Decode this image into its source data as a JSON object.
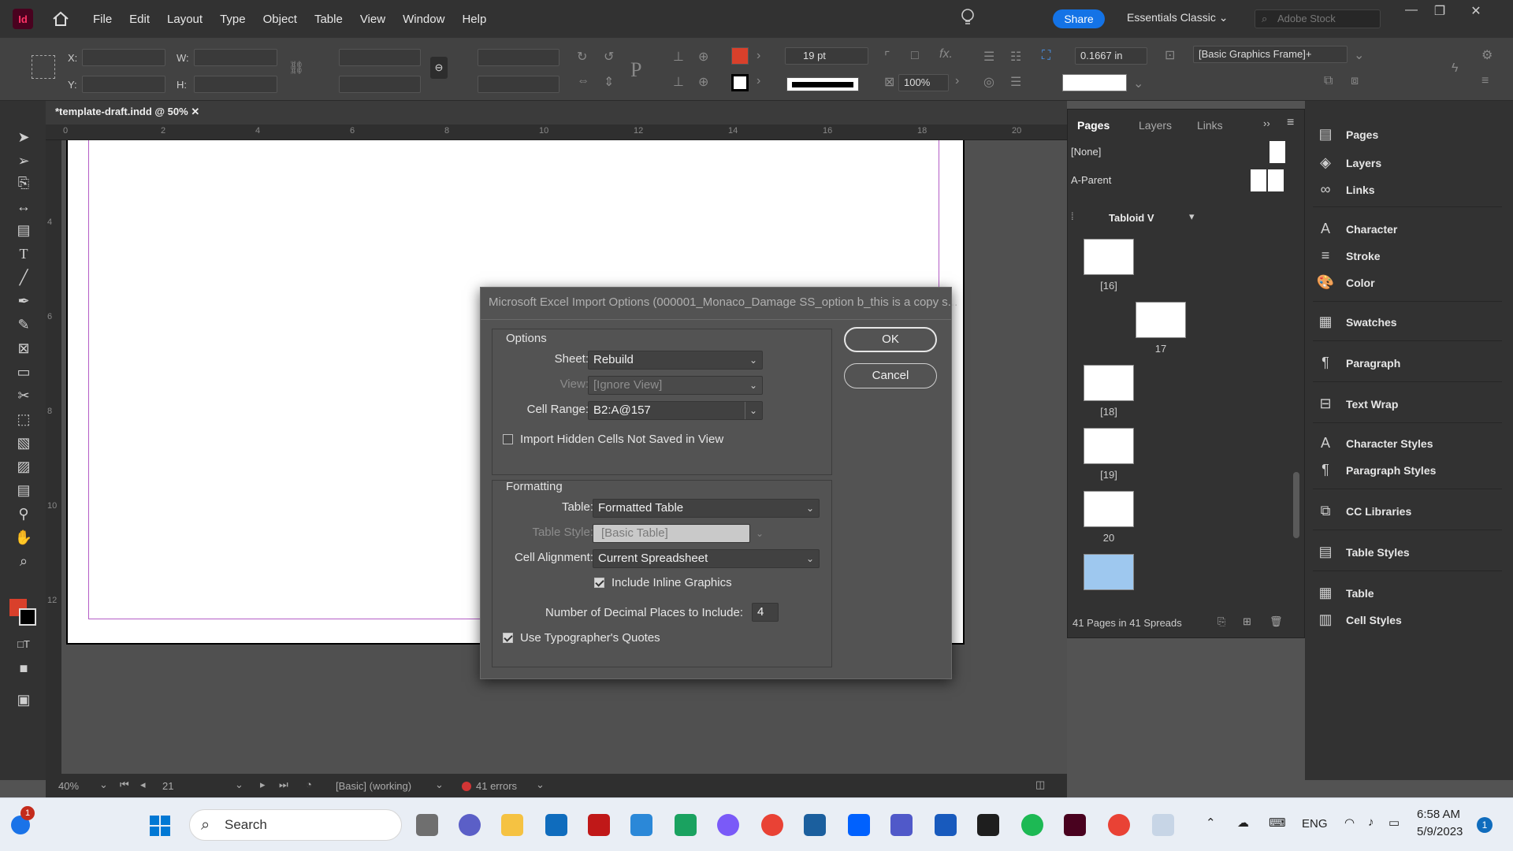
{
  "app": {
    "logo": "Id",
    "menu": [
      "File",
      "Edit",
      "Layout",
      "Type",
      "Object",
      "Table",
      "View",
      "Window",
      "Help"
    ],
    "share_label": "Share",
    "workspace": "Essentials Classic",
    "stock_placeholder": "Adobe Stock"
  },
  "controlbar": {
    "x_label": "X:",
    "y_label": "Y:",
    "w_label": "W:",
    "h_label": "H:",
    "stroke_weight": "19 pt",
    "opacity": "100%",
    "offset": "0.1667 in",
    "object_style": "[Basic Graphics Frame]+",
    "fill_color": "#d9402b",
    "stroke_color": "#000000"
  },
  "document": {
    "tab_title": "*template-draft.indd @ 50%",
    "ruler_marks": [
      "0",
      "2",
      "4",
      "6",
      "8",
      "10",
      "12",
      "14",
      "16",
      "18",
      "20"
    ],
    "ruler_marks_left": [
      "4",
      "6",
      "8",
      "10",
      "12"
    ]
  },
  "status": {
    "zoom": "40%",
    "page": "21",
    "preflight_profile": "[Basic] (working)",
    "errors": "41 errors"
  },
  "pages_panel": {
    "tabs": [
      "Pages",
      "Layers",
      "Links"
    ],
    "parents": [
      "[None]",
      "A-Parent"
    ],
    "size": "Tabloid V",
    "pages": [
      "[16]",
      "17",
      "[18]",
      "[19]",
      "20"
    ],
    "footer": "41 Pages in 41 Spreads"
  },
  "dock": {
    "items": [
      "Pages",
      "Layers",
      "Links",
      "Character",
      "Stroke",
      "Color",
      "Swatches",
      "Paragraph",
      "Text Wrap",
      "Character Styles",
      "Paragraph Styles",
      "CC Libraries",
      "Table Styles",
      "Table",
      "Cell Styles"
    ]
  },
  "dialog": {
    "title": "Microsoft Excel Import Options (000001_Monaco_Damage SS_option b_this is a copy s...",
    "ok": "OK",
    "cancel": "Cancel",
    "options_title": "Options",
    "sheet_label": "Sheet:",
    "sheet_value": "Rebuild",
    "view_label": "View:",
    "view_value": "[Ignore View]",
    "range_label": "Cell Range:",
    "range_value": "B2:A@157",
    "hidden_cells_label": "Import Hidden Cells Not Saved in View",
    "formatting_title": "Formatting",
    "table_label": "Table:",
    "table_value": "Formatted Table",
    "table_style_label": "Table Style:",
    "table_style_value": "[Basic Table]",
    "alignment_label": "Cell Alignment:",
    "alignment_value": "Current Spreadsheet",
    "inline_graphics_label": "Include Inline Graphics",
    "decimal_label": "Number of Decimal Places to Include:",
    "decimal_value": "4",
    "quotes_label": "Use Typographer's Quotes"
  },
  "taskbar": {
    "search_label": "Search",
    "language": "ENG",
    "time": "6:58 AM",
    "date": "5/9/2023",
    "notification_count": "1"
  }
}
